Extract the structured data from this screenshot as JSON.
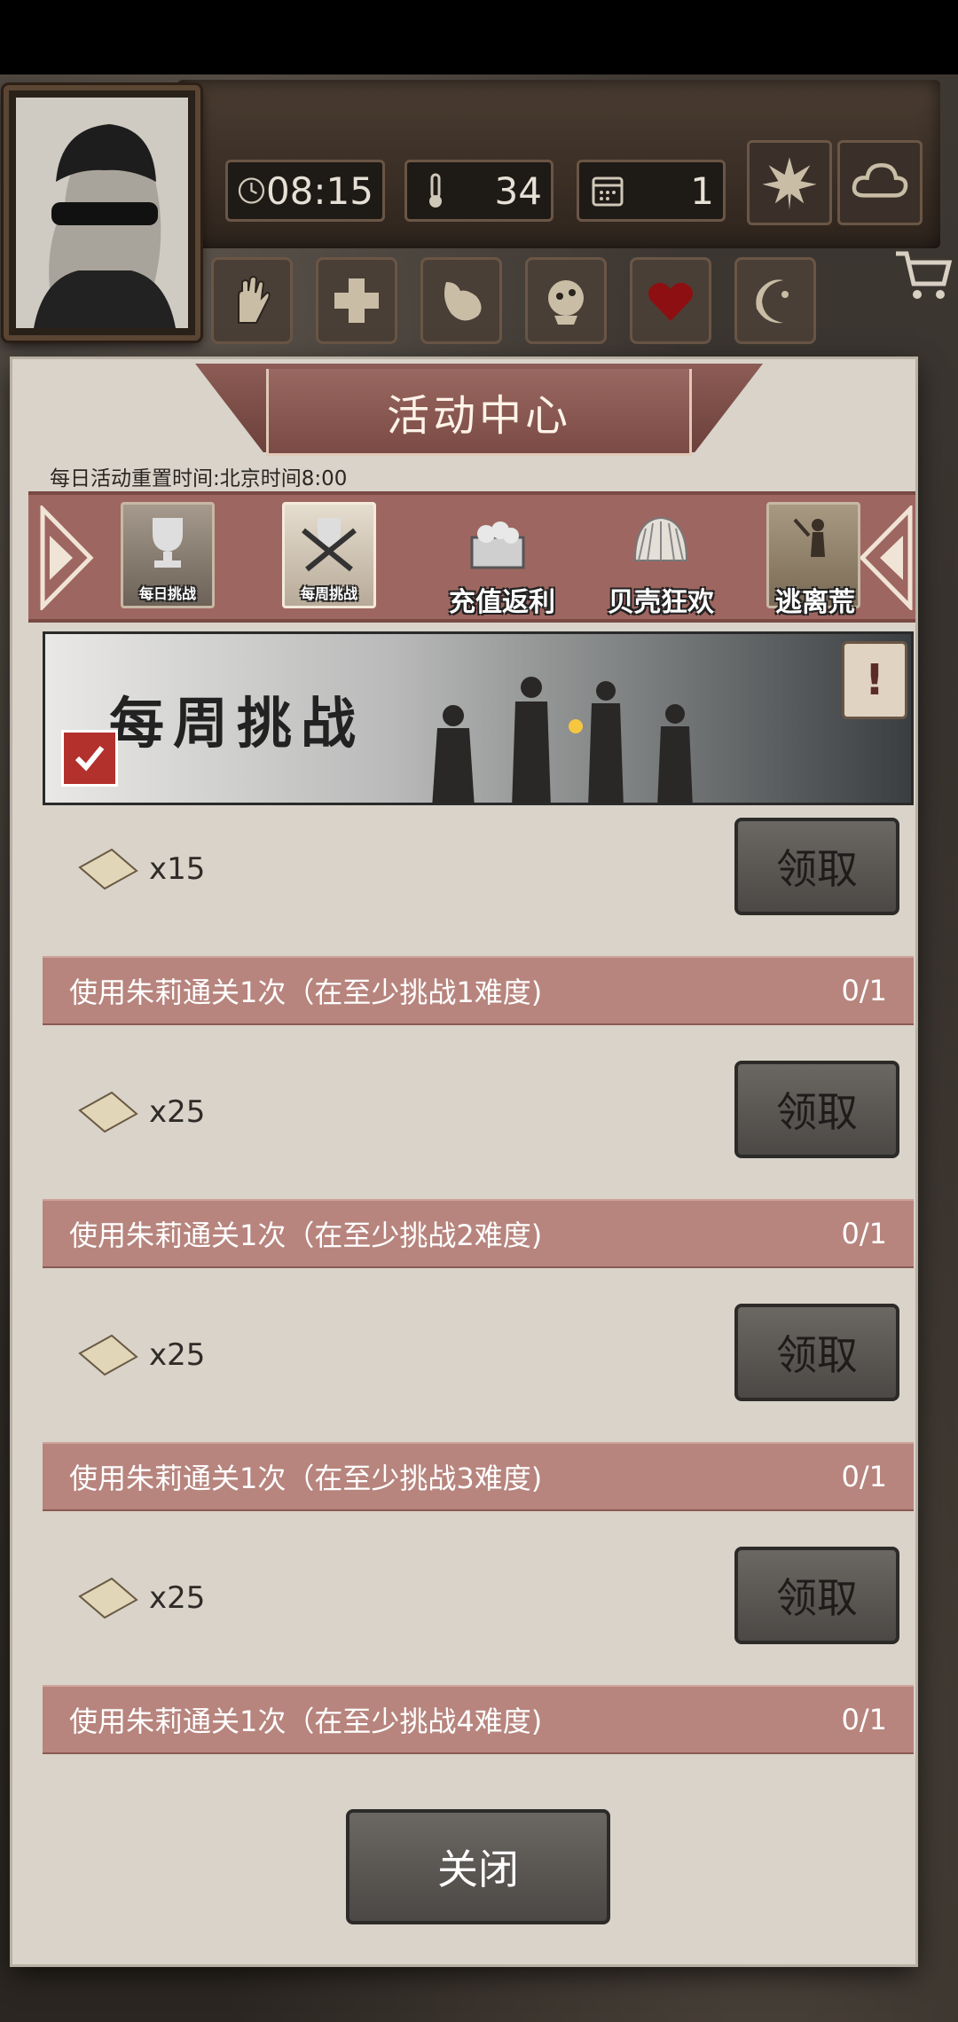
{
  "hud": {
    "time": "08:15",
    "temperature": "34",
    "day": "1",
    "icons": [
      "leaf-icon",
      "cloud-icon",
      "hand-icon",
      "medical-cross-icon",
      "stomach-icon",
      "brain-icon",
      "heart-icon",
      "moon-icon",
      "cart-icon"
    ]
  },
  "panel": {
    "title": "活动中心",
    "reset_notice": "每日活动重置时间:北京时间8:00"
  },
  "tabs": [
    {
      "label": "每日挑战",
      "selected": false,
      "small": true
    },
    {
      "label": "每周挑战",
      "selected": true,
      "small": true
    },
    {
      "label": "充值返利",
      "selected": false,
      "small": false
    },
    {
      "label": "贝壳狂欢",
      "selected": false,
      "small": false
    },
    {
      "label": "逃离荒",
      "selected": false,
      "small": false
    }
  ],
  "banner": {
    "title": "每周挑战",
    "info_symbol": "!"
  },
  "tasks": [
    {
      "reward_count": "x15",
      "claim_label": "领取",
      "requirement": "使用朱莉通关1次（在至少挑战1难度)",
      "progress": "0/1"
    },
    {
      "reward_count": "x25",
      "claim_label": "领取",
      "requirement": "使用朱莉通关1次（在至少挑战2难度)",
      "progress": "0/1"
    },
    {
      "reward_count": "x25",
      "claim_label": "领取",
      "requirement": "使用朱莉通关1次（在至少挑战3难度)",
      "progress": "0/1"
    },
    {
      "reward_count": "x25",
      "claim_label": "领取",
      "requirement": "使用朱莉通关1次（在至少挑战4难度)",
      "progress": "0/1"
    }
  ],
  "close_label": "关闭",
  "colors": {
    "accent_red": "#9e6660",
    "claim_gray": "#5b5855",
    "panel_bg": "#d9d3c9"
  }
}
